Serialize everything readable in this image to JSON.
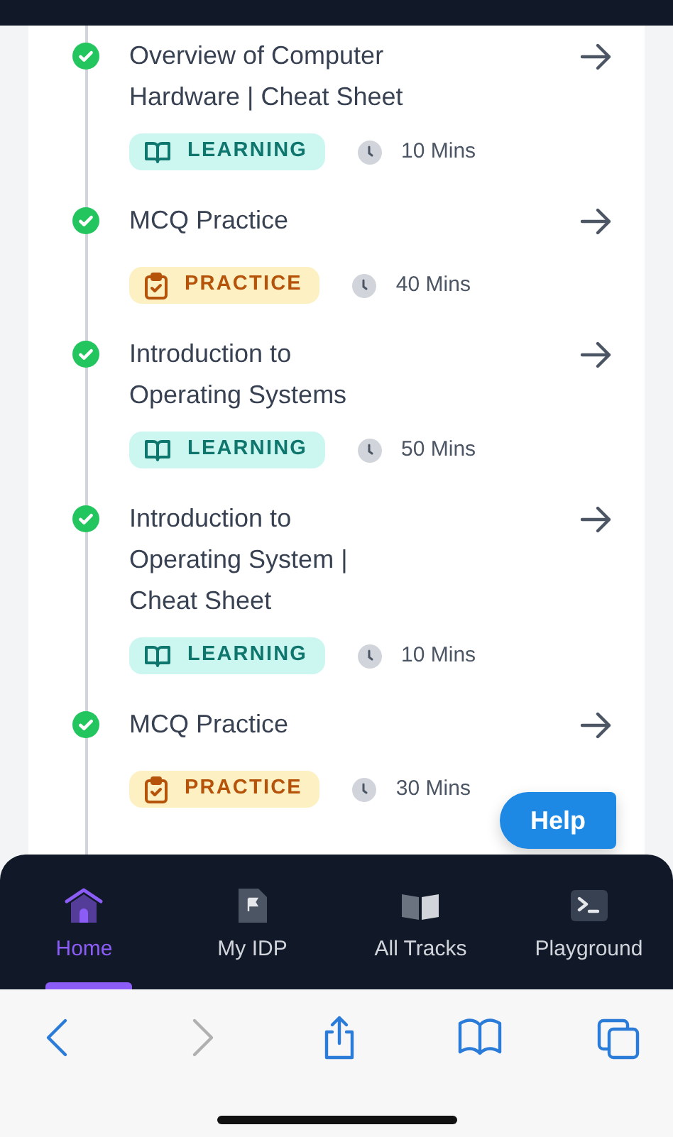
{
  "lessons": [
    {
      "title": "Overview of Computer Hardware | Cheat Sheet",
      "completed": true,
      "tag": {
        "kind": "learning",
        "label": "LEARNING"
      },
      "duration": "10 Mins"
    },
    {
      "title": "MCQ Practice",
      "completed": true,
      "tag": {
        "kind": "practice",
        "label": "PRACTICE"
      },
      "duration": "40 Mins"
    },
    {
      "title": "Introduction to Operating Systems",
      "completed": true,
      "tag": {
        "kind": "learning",
        "label": "LEARNING"
      },
      "duration": "50 Mins"
    },
    {
      "title": "Introduction to Operating System | Cheat Sheet",
      "completed": true,
      "tag": {
        "kind": "learning",
        "label": "LEARNING"
      },
      "duration": "10 Mins"
    },
    {
      "title": "MCQ Practice",
      "completed": true,
      "tag": {
        "kind": "practice",
        "label": "PRACTICE"
      },
      "duration": "30 Mins"
    }
  ],
  "help_button": "Help",
  "bottom_nav": [
    {
      "kind": "home",
      "label": "Home",
      "selected": true
    },
    {
      "kind": "idp",
      "label": "My IDP",
      "selected": false
    },
    {
      "kind": "tracks",
      "label": "All Tracks",
      "selected": false
    },
    {
      "kind": "playground",
      "label": "Playground",
      "selected": false
    }
  ],
  "browser_toolbar": [
    {
      "kind": "back",
      "disabled": false
    },
    {
      "kind": "forward",
      "disabled": true
    },
    {
      "kind": "share",
      "disabled": false
    },
    {
      "kind": "bookmarks",
      "disabled": false
    },
    {
      "kind": "tabs",
      "disabled": false
    }
  ]
}
